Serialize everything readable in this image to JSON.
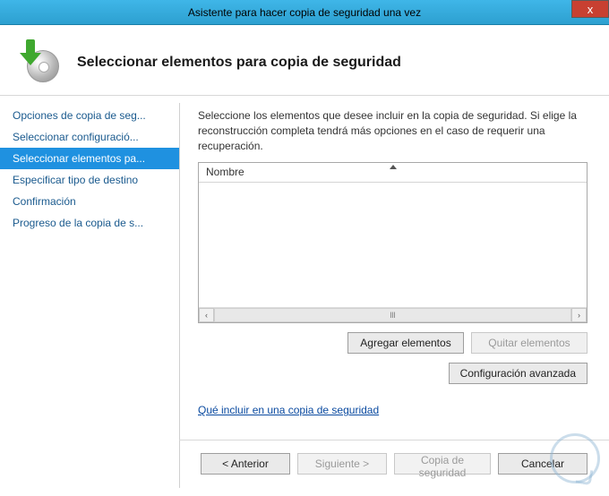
{
  "titlebar": {
    "title": "Asistente para hacer copia de seguridad una vez",
    "close": "x"
  },
  "header": {
    "title": "Seleccionar elementos para copia de seguridad"
  },
  "sidebar": {
    "items": [
      {
        "label": "Opciones de copia de seg..."
      },
      {
        "label": "Seleccionar configuració..."
      },
      {
        "label": "Seleccionar elementos pa..."
      },
      {
        "label": "Especificar tipo de destino"
      },
      {
        "label": "Confirmación"
      },
      {
        "label": "Progreso de la copia de s..."
      }
    ],
    "selected_index": 2
  },
  "main": {
    "instructions": "Seleccione los elementos que desee incluir en la copia de seguridad. Si elige la reconstrucción completa tendrá más opciones en el caso de requerir una recuperación.",
    "list": {
      "column_header": "Nombre"
    },
    "add_button": "Agregar elementos",
    "remove_button": "Quitar elementos",
    "advanced_button": "Configuración avanzada",
    "help_link": "Qué incluir en una copia de seguridad"
  },
  "footer": {
    "back": "< Anterior",
    "next": "Siguiente >",
    "backup": "Copia de seguridad",
    "cancel": "Cancelar"
  }
}
